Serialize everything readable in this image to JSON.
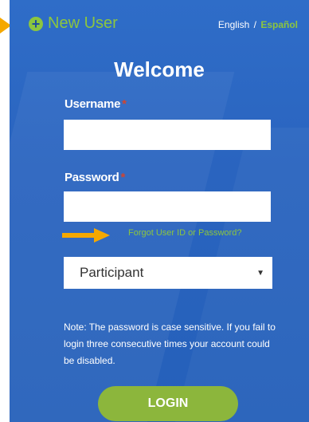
{
  "header": {
    "new_user_label": "New User",
    "language": {
      "english": "English",
      "separator": "/",
      "spanish": "Español"
    }
  },
  "form": {
    "title": "Welcome",
    "username_label": "Username",
    "password_label": "Password",
    "required_mark": "*",
    "username_value": "",
    "password_value": "",
    "forgot_link": "Forgot User ID or Password?",
    "role_selected": "Participant",
    "note": "Note: The password is case sensitive. If you fail to login three consecutive times your account could be disabled.",
    "login_label": "LOGIN"
  },
  "colors": {
    "panel_blue": "#2a64bf",
    "accent_green": "#8cc63f",
    "annotation_orange": "#f5a800",
    "required_red": "#d0452f"
  },
  "icons": {
    "new_user": "plus-circle-icon",
    "select_caret": "caret-down-icon"
  }
}
